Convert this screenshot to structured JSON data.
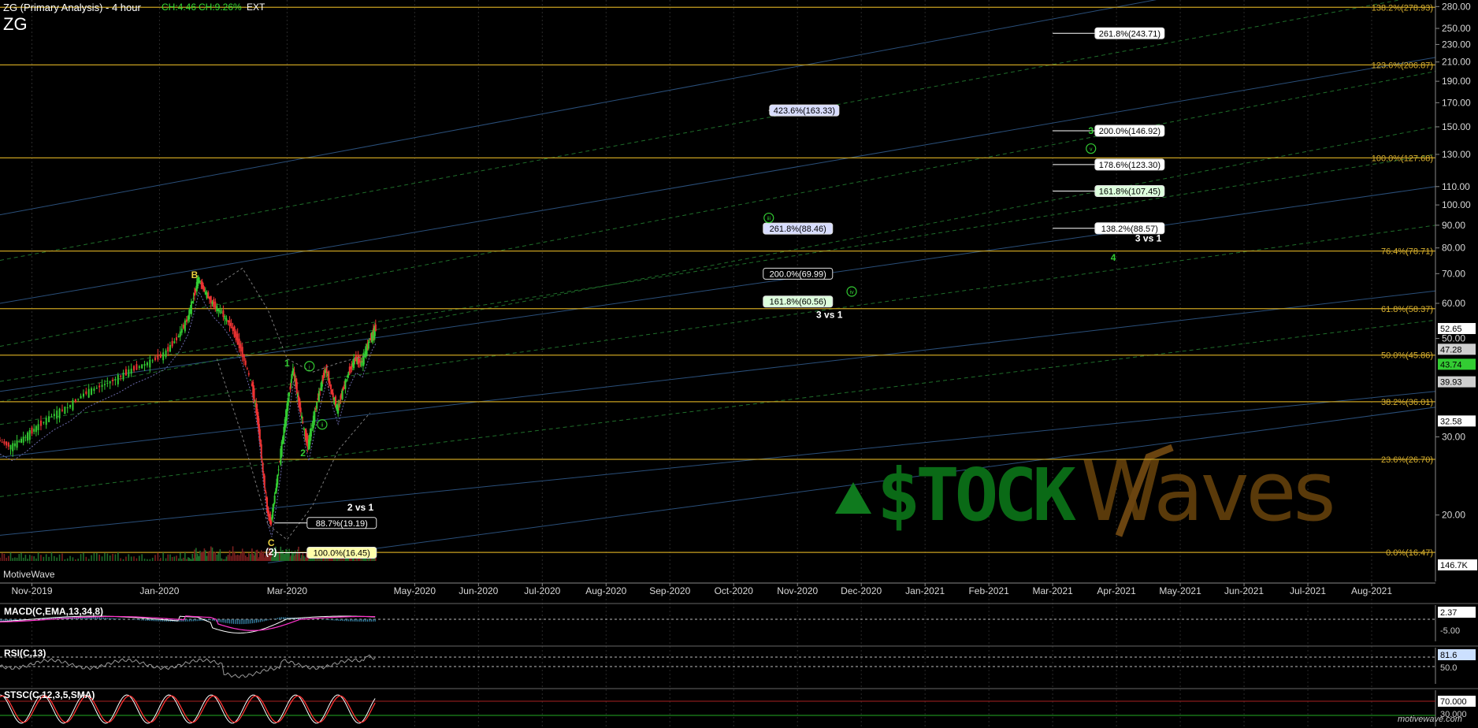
{
  "header": {
    "title": "ZG (Primary Analysis) - 4 hour",
    "change_abs": "CH:4.46",
    "change_pct": "CH:9.26%",
    "session": "EXT",
    "symbol": "ZG"
  },
  "footer": {
    "watermark": "MotiveWave",
    "logo": "motivewave.com"
  },
  "overlay_logo": "StockWaves",
  "colors": {
    "background": "#000000",
    "fib_line": "#c8a020",
    "fib_text": "#d8b030",
    "up_candle": "#33cc33",
    "down_candle": "#ee3333",
    "wave_green": "#33cc33",
    "wave_yellow": "#e8d040",
    "trend_blue": "#2a4f7a",
    "trend_green": "#1f6e2a",
    "macd": "#ffffff",
    "signal": "#ff33cc",
    "rsi_line": "#999999",
    "stoch_k": "#ffffff",
    "stoch_d": "#ff3333"
  },
  "chart_data": {
    "type": "candlestick",
    "title": "ZG (Primary Analysis) - 4 hour",
    "x_axis": {
      "tick_labels": [
        "Nov-2019",
        "Jan-2020",
        "Mar-2020",
        "May-2020",
        "Jun-2020",
        "Jul-2020",
        "Aug-2020",
        "Sep-2020",
        "Oct-2020",
        "Nov-2020",
        "Dec-2020",
        "Jan-2021",
        "Feb-2021",
        "Mar-2021",
        "Apr-2021",
        "May-2021",
        "Jun-2021",
        "Jul-2021",
        "Aug-2021"
      ],
      "tick_months": [
        0,
        2,
        4,
        6,
        7,
        8,
        9,
        10,
        11,
        12,
        13,
        14,
        15,
        16,
        17,
        18,
        19,
        20,
        21
      ],
      "start_month": -0.5,
      "end_month": 22.0
    },
    "y_axis": {
      "scale": "log",
      "range": [
        15.5,
        285
      ],
      "tick_labels": [
        "280.00",
        "250.00",
        "230.00",
        "210.00",
        "190.00",
        "170.00",
        "150.00",
        "130.00",
        "110.00",
        "100.00",
        "90.00",
        "80.00",
        "70.00",
        "60.00",
        "50.00",
        "30.00",
        "20.00"
      ],
      "tick_values": [
        280,
        250,
        230,
        210,
        190,
        170,
        150,
        130,
        110,
        100,
        90,
        80,
        70,
        60,
        50,
        30,
        20
      ]
    },
    "price_tags": [
      {
        "text": "52.65",
        "value": 52.65,
        "color": "#ffffff",
        "text_color": "#000000"
      },
      {
        "text": "47.28",
        "value": 47.28,
        "color": "#cfcfcf",
        "text_color": "#000000"
      },
      {
        "text": "43.74",
        "value": 43.74,
        "color": "#33cc33",
        "text_color": "#000000"
      },
      {
        "text": "39.93",
        "value": 39.93,
        "color": "#cfcfcf",
        "text_color": "#000000"
      },
      {
        "text": "32.58",
        "value": 32.58,
        "color": "#ffffff",
        "text_color": "#000000"
      }
    ],
    "volume_tag": "146.7K",
    "fib_levels": [
      {
        "label": "138.2%(278.93)",
        "value": 278.93
      },
      {
        "label": "123.6%(206.87)",
        "value": 206.87
      },
      {
        "label": "100.0%(127.68)",
        "value": 127.68
      },
      {
        "label": "76.4%(78.71)",
        "value": 78.71
      },
      {
        "label": "61.8%(58.37)",
        "value": 58.37
      },
      {
        "label": "50.0%(45.86)",
        "value": 45.86
      },
      {
        "label": "38.2%(36.01)",
        "value": 36.01
      },
      {
        "label": "23.6%(26.70)",
        "value": 26.7
      },
      {
        "label": "0.0%(16.47)",
        "value": 16.47
      }
    ],
    "projection_boxes": [
      {
        "label": "261.8%(243.71)",
        "value": 243.71,
        "x1": 16.0,
        "x2": 17.75,
        "fill": "#ffffff",
        "text": "#000000"
      },
      {
        "label": "423.6%(163.33)",
        "value": 163.33,
        "x1": 11.55,
        "x2": 12.65,
        "fill": "#d8ddff",
        "text": "#000000"
      },
      {
        "label": "200.0%(146.92)",
        "value": 146.92,
        "x1": 16.0,
        "x2": 17.75,
        "fill": "#ffffff",
        "text": "#000000"
      },
      {
        "label": "178.6%(123.30)",
        "value": 123.3,
        "x1": 16.0,
        "x2": 17.75,
        "fill": "#ffffff",
        "text": "#000000"
      },
      {
        "label": "161.8%(107.45)",
        "value": 107.45,
        "x1": 16.0,
        "x2": 17.75,
        "fill": "#ddffdd",
        "text": "#000000"
      },
      {
        "label": "261.8%(88.46)",
        "value": 88.46,
        "x1": 11.55,
        "x2": 12.55,
        "fill": "#d8ddff",
        "text": "#000000"
      },
      {
        "label": "138.2%(88.57)",
        "value": 88.57,
        "x1": 16.0,
        "x2": 17.75,
        "fill": "#ffffff",
        "text": "#000000"
      },
      {
        "label": "200.0%(69.99)",
        "value": 69.99,
        "x1": 11.55,
        "x2": 12.55,
        "fill": "#000000",
        "text": "#ffffff"
      },
      {
        "label": "161.8%(60.56)",
        "value": 60.56,
        "x1": 11.55,
        "x2": 12.55,
        "fill": "#ddffdd",
        "text": "#000000"
      },
      {
        "label": "88.7%(19.19)",
        "value": 19.19,
        "x1": 3.8,
        "x2": 5.4,
        "fill": "#000000",
        "text": "#ffffff"
      },
      {
        "label": "100.0%(16.45)",
        "value": 16.45,
        "x1": 3.8,
        "x2": 5.4,
        "fill": "#ffffaa",
        "text": "#000000"
      }
    ],
    "text_notes": [
      {
        "text": "3 vs 1",
        "month": 17.5,
        "value": 84.0,
        "color": "#ffffff"
      },
      {
        "text": "3 vs 1",
        "month": 12.5,
        "value": 56.5,
        "color": "#ffffff"
      },
      {
        "text": "2 vs 1",
        "month": 5.15,
        "value": 20.8,
        "color": "#ffffff"
      }
    ],
    "wave_labels": [
      {
        "text": "B",
        "month": 2.55,
        "value": 69.5,
        "color": "#e8d040",
        "shape": "plain"
      },
      {
        "text": "C",
        "month": 3.75,
        "value": 17.3,
        "color": "#e8d040",
        "shape": "plain"
      },
      {
        "text": "(2)",
        "month": 3.75,
        "value": 16.5,
        "color": "#ffffff",
        "shape": "plain"
      },
      {
        "text": "1",
        "month": 4.0,
        "value": 44.0,
        "color": "#33cc33",
        "shape": "plain"
      },
      {
        "text": "2",
        "month": 4.25,
        "value": 27.6,
        "color": "#33cc33",
        "shape": "plain"
      },
      {
        "text": "i",
        "month": 4.35,
        "value": 43.3,
        "color": "#33cc33",
        "shape": "circle"
      },
      {
        "text": "ii",
        "month": 4.55,
        "value": 32.0,
        "color": "#33cc33",
        "shape": "circle"
      },
      {
        "text": "iii",
        "month": 11.55,
        "value": 93.5,
        "color": "#33cc33",
        "shape": "circle"
      },
      {
        "text": "iv",
        "month": 12.85,
        "value": 63.8,
        "color": "#33cc33",
        "shape": "circle"
      },
      {
        "text": "v",
        "month": 16.6,
        "value": 134.0,
        "color": "#33cc33",
        "shape": "circle"
      },
      {
        "text": "3",
        "month": 16.6,
        "value": 147.0,
        "color": "#33cc33",
        "shape": "plain"
      },
      {
        "text": "4",
        "month": 16.95,
        "value": 76.0,
        "color": "#33cc33",
        "shape": "plain"
      }
    ],
    "price_path": [
      [
        -0.5,
        29.5
      ],
      [
        -0.3,
        28.5
      ],
      [
        -0.1,
        29.8
      ],
      [
        0.1,
        31.5
      ],
      [
        0.35,
        33.5
      ],
      [
        0.6,
        35.0
      ],
      [
        0.85,
        37.5
      ],
      [
        1.1,
        39.0
      ],
      [
        1.35,
        40.5
      ],
      [
        1.6,
        42.5
      ],
      [
        1.85,
        44.0
      ],
      [
        2.1,
        46.0
      ],
      [
        2.3,
        50.0
      ],
      [
        2.45,
        55.0
      ],
      [
        2.55,
        62.0
      ],
      [
        2.62,
        68.5
      ],
      [
        2.72,
        64.0
      ],
      [
        2.85,
        60.0
      ],
      [
        3.0,
        57.0
      ],
      [
        3.15,
        53.0
      ],
      [
        3.3,
        47.0
      ],
      [
        3.45,
        40.0
      ],
      [
        3.55,
        33.0
      ],
      [
        3.62,
        26.0
      ],
      [
        3.7,
        20.5
      ],
      [
        3.76,
        19.2
      ],
      [
        3.85,
        23.5
      ],
      [
        3.95,
        30.0
      ],
      [
        4.05,
        38.0
      ],
      [
        4.1,
        43.0
      ],
      [
        4.18,
        37.0
      ],
      [
        4.28,
        31.0
      ],
      [
        4.34,
        28.5
      ],
      [
        4.45,
        34.0
      ],
      [
        4.55,
        39.5
      ],
      [
        4.62,
        43.0
      ],
      [
        4.72,
        37.5
      ],
      [
        4.8,
        34.5
      ],
      [
        4.88,
        38.0
      ],
      [
        4.98,
        42.0
      ],
      [
        5.08,
        45.0
      ],
      [
        5.18,
        44.0
      ],
      [
        5.25,
        47.0
      ],
      [
        5.33,
        50.5
      ],
      [
        5.4,
        52.65
      ]
    ],
    "indicators": {
      "macd": {
        "label": "MACD(C,EMA,13,34,8)",
        "tags": [
          {
            "text": "2.37",
            "color": "#ffffff"
          },
          {
            "text": "-5.00",
            "color": "#000000",
            "text_color": "#cccccc"
          }
        ]
      },
      "rsi": {
        "label": "RSI(C,13)",
        "tags": [
          {
            "text": "81.6",
            "color": "#cce0ff"
          },
          {
            "text": "50.0",
            "color": "#000000",
            "text_color": "#cccccc"
          }
        ]
      },
      "stochastic": {
        "label": "STSC(C,12,3,5,SMA)",
        "tags": [
          {
            "text": "70.000",
            "color": "#ffffff"
          },
          {
            "text": "30.000",
            "color": "#000000",
            "text_color": "#cccccc"
          }
        ]
      }
    }
  }
}
